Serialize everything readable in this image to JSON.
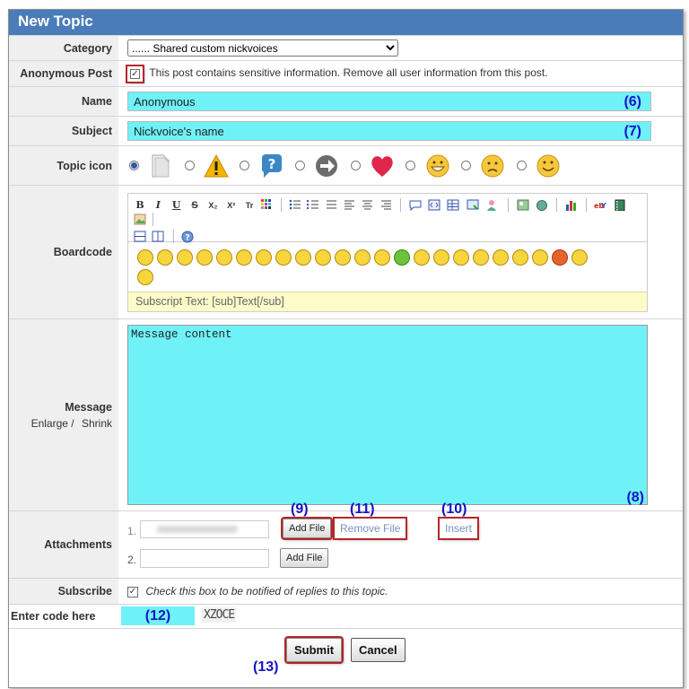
{
  "title": "New Topic",
  "labels": {
    "category": "Category",
    "anonymous": "Anonymous Post",
    "name": "Name",
    "subject": "Subject",
    "topic_icon": "Topic icon",
    "boardcode": "Boardcode",
    "message": "Message",
    "attachments": "Attachments",
    "subscribe": "Subscribe",
    "enter_code": "Enter code here"
  },
  "category": {
    "selected": "...... Shared custom nickvoices"
  },
  "anonymous": {
    "checked": true,
    "text": "This post contains sensitive information. Remove all user information from this post."
  },
  "name": {
    "value": "Anonymous",
    "marker": "(6)"
  },
  "subject": {
    "value": "Nickvoice's name",
    "marker": "(7)"
  },
  "boardcode": {
    "toolbar": [
      "B",
      "I",
      "U",
      "S",
      "X₂",
      "X²",
      "Tr"
    ],
    "hint": "Subscript Text: [sub]Text[/sub]"
  },
  "message": {
    "value": "Message content",
    "marker": "(8)",
    "enlarge": "Enlarge",
    "slash": "/",
    "shrink": "Shrink"
  },
  "attachments": {
    "row1_num": "1.",
    "row2_num": "2.",
    "add_file": "Add File",
    "remove_file": "Remove File",
    "insert": "Insert",
    "marker_add": "(9)",
    "marker_remove": "(11)",
    "marker_insert": "(10)"
  },
  "subscribe": {
    "checked": true,
    "text": "Check this box to be notified of replies to this topic."
  },
  "captcha": {
    "marker": "(12)",
    "code": "XZOCE"
  },
  "buttons": {
    "submit": "Submit",
    "cancel": "Cancel",
    "marker": "(13)"
  },
  "colors": {
    "titlebar": "#4a7cb9",
    "highlight": "#6ff2f7",
    "annotation": "#1414c8",
    "annotation_border": "#b3262b",
    "hint_bg": "#fdfbc8"
  }
}
